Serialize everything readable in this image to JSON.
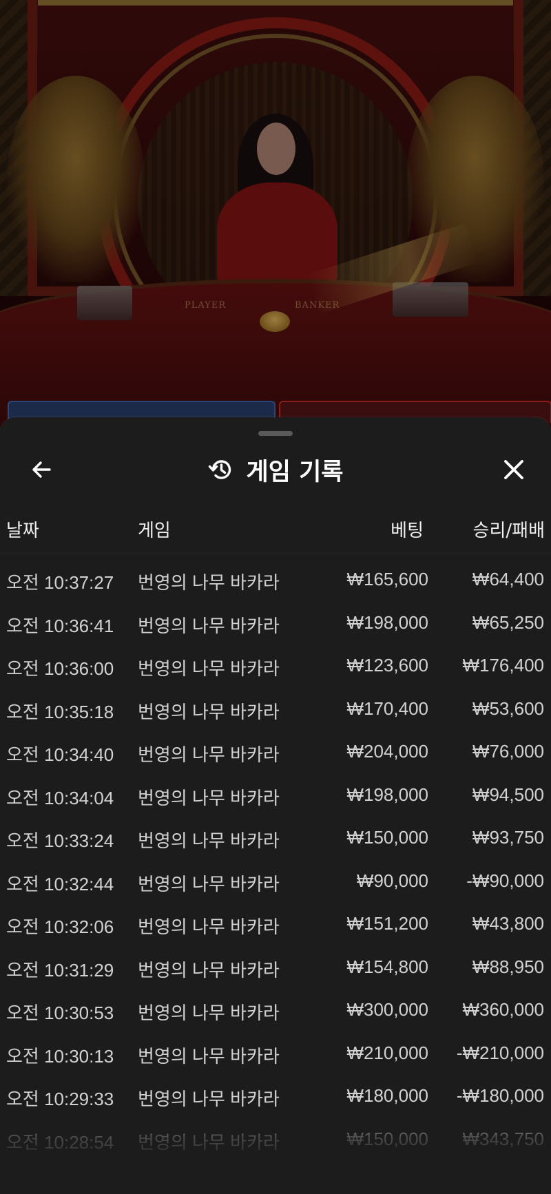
{
  "header": {
    "title": "게임 기록",
    "back_icon": "arrow-left-icon",
    "history_icon": "history-icon",
    "close_icon": "close-icon"
  },
  "video": {
    "table_labels": [
      "PLAYER",
      "BANKER"
    ]
  },
  "columns": {
    "date": "날짜",
    "game": "게임",
    "bet": "베팅",
    "result": "승리/패배"
  },
  "rows": [
    {
      "time": "오전 10:37:27",
      "game": "번영의 나무 바카라",
      "bet": "₩165,600",
      "result": "₩64,400"
    },
    {
      "time": "오전 10:36:41",
      "game": "번영의 나무 바카라",
      "bet": "₩198,000",
      "result": "₩65,250"
    },
    {
      "time": "오전 10:36:00",
      "game": "번영의 나무 바카라",
      "bet": "₩123,600",
      "result": "₩176,400"
    },
    {
      "time": "오전 10:35:18",
      "game": "번영의 나무 바카라",
      "bet": "₩170,400",
      "result": "₩53,600"
    },
    {
      "time": "오전 10:34:40",
      "game": "번영의 나무 바카라",
      "bet": "₩204,000",
      "result": "₩76,000"
    },
    {
      "time": "오전 10:34:04",
      "game": "번영의 나무 바카라",
      "bet": "₩198,000",
      "result": "₩94,500"
    },
    {
      "time": "오전 10:33:24",
      "game": "번영의 나무 바카라",
      "bet": "₩150,000",
      "result": "₩93,750"
    },
    {
      "time": "오전 10:32:44",
      "game": "번영의 나무 바카라",
      "bet": "₩90,000",
      "result": "-₩90,000"
    },
    {
      "time": "오전 10:32:06",
      "game": "번영의 나무 바카라",
      "bet": "₩151,200",
      "result": "₩43,800"
    },
    {
      "time": "오전 10:31:29",
      "game": "번영의 나무 바카라",
      "bet": "₩154,800",
      "result": "₩88,950"
    },
    {
      "time": "오전 10:30:53",
      "game": "번영의 나무 바카라",
      "bet": "₩300,000",
      "result": "₩360,000"
    },
    {
      "time": "오전 10:30:13",
      "game": "번영의 나무 바카라",
      "bet": "₩210,000",
      "result": "-₩210,000"
    },
    {
      "time": "오전 10:29:33",
      "game": "번영의 나무 바카라",
      "bet": "₩180,000",
      "result": "-₩180,000"
    },
    {
      "time": "오전 10:28:54",
      "game": "번영의 나무 바카라",
      "bet": "₩150,000",
      "result": "₩343,750"
    }
  ],
  "colors": {
    "sheet_bg": "#1c1c1c",
    "text_primary": "#ffffff",
    "text_row": "#d2d2d2"
  }
}
